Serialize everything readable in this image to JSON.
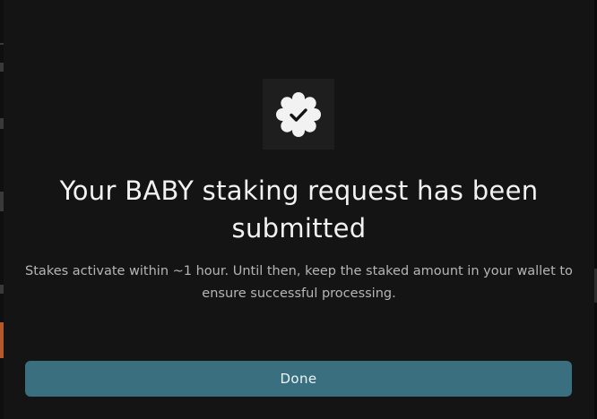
{
  "modal": {
    "icon": "badge-check-icon",
    "title": "Your BABY staking request has been submitted",
    "description": "Stakes activate within ~1 hour. Until then, keep the staked amount in your wallet to ensure successful processing.",
    "done_label": "Done"
  },
  "colors": {
    "modal_background": "#141414",
    "button_background": "#3a6f80",
    "title_text": "#f2f2f2",
    "description_text": "#b6b6b6",
    "icon_fill": "#f2f2f2"
  }
}
